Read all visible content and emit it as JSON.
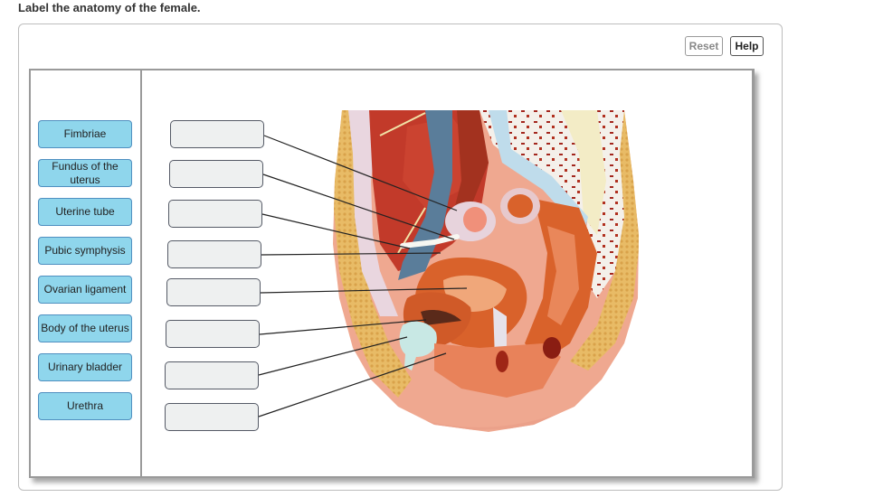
{
  "prompt": "Label the anatomy of the female.",
  "toolbar": {
    "reset_label": "Reset",
    "help_label": "Help"
  },
  "labels": [
    {
      "text": "Fimbriae"
    },
    {
      "text": "Fundus of the uterus"
    },
    {
      "text": "Uterine tube"
    },
    {
      "text": "Pubic symphysis"
    },
    {
      "text": "Ovarian ligament"
    },
    {
      "text": "Body of the uterus"
    },
    {
      "text": "Urinary bladder"
    },
    {
      "text": "Urethra"
    }
  ],
  "drop_targets": [
    {
      "value": ""
    },
    {
      "value": ""
    },
    {
      "value": ""
    },
    {
      "value": ""
    },
    {
      "value": ""
    },
    {
      "value": ""
    },
    {
      "value": ""
    },
    {
      "value": ""
    }
  ],
  "figure": {
    "description": "Sagittal section of female pelvis model",
    "colors": {
      "label_fill": "#8fd6ec",
      "label_border": "#4f8fc0",
      "drop_fill": "#eef0f0",
      "skin": "#efa890",
      "muscle": "#c0392b",
      "uterus": "#d9622b",
      "bladder": "#c8e8e4",
      "fat": "#e6b860",
      "bone_bg": "#f3efe8",
      "vessel": "#5a7d9a"
    }
  }
}
